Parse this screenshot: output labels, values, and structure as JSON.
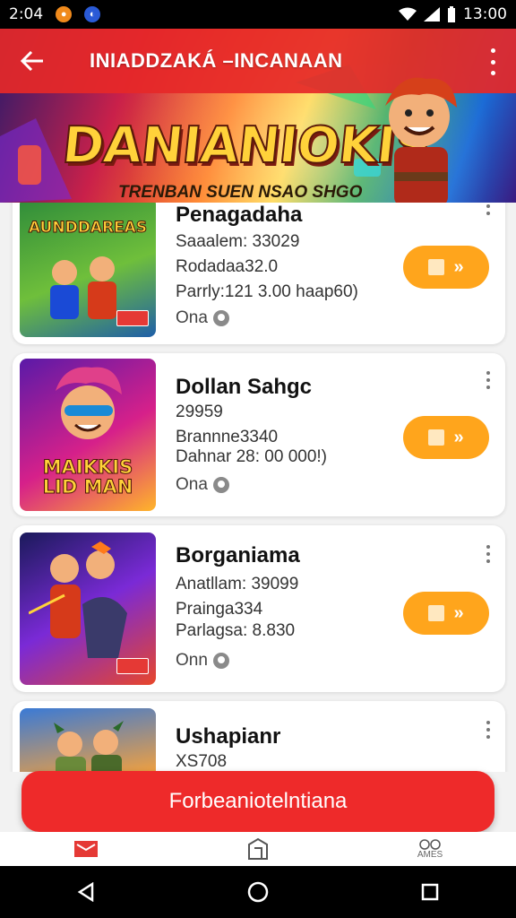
{
  "status_bar": {
    "time_left": "2:04",
    "time_right": "13:00"
  },
  "app_bar": {
    "title": "INIADDZAKÁ –INCANAAN"
  },
  "banner": {
    "title": "DANIANIOKIS",
    "subtitle": "TRENBAN SUEN NSAO SHGO"
  },
  "games": [
    {
      "name": "Penagadaha",
      "meta1": "Saaalem: 33029",
      "meta2": "Rodadaa32.0",
      "meta3": "Parrly:121 3.00 haap60)",
      "status": "Ona",
      "thumb_title": "AUNDDAREAS",
      "thumb_colors": [
        "#2e8b3a",
        "#6fbf3b",
        "#1f5fa8"
      ]
    },
    {
      "name": "Dollan Sahgc",
      "meta1": "29959",
      "meta2": "Brannne3340",
      "meta3": "Dahnar 28: 00 000!)",
      "status": "Ona",
      "thumb_title": "MAIKKIS LID MAN",
      "thumb_colors": [
        "#5a1aa8",
        "#d6208a",
        "#ffb52a"
      ]
    },
    {
      "name": "Borganiama",
      "meta1": "Anatllam: 39099",
      "meta2": "Praingа334",
      "meta3": "Parlagsa: 8.830",
      "status": "Onn",
      "thumb_title": "",
      "thumb_colors": [
        "#1a1a5a",
        "#7a2ad6",
        "#e8462a"
      ]
    },
    {
      "name": "Ushapianr",
      "meta1": "XS708",
      "meta2": "",
      "meta3": "",
      "status": "",
      "thumb_title": "",
      "thumb_colors": [
        "#3a7ad6",
        "#f0a040",
        "#4a8a3a"
      ]
    }
  ],
  "cta": {
    "label": "Forbeaniotelntiana"
  },
  "tabs": [
    {
      "label": ""
    },
    {
      "label": ""
    },
    {
      "label": "AMES"
    }
  ]
}
